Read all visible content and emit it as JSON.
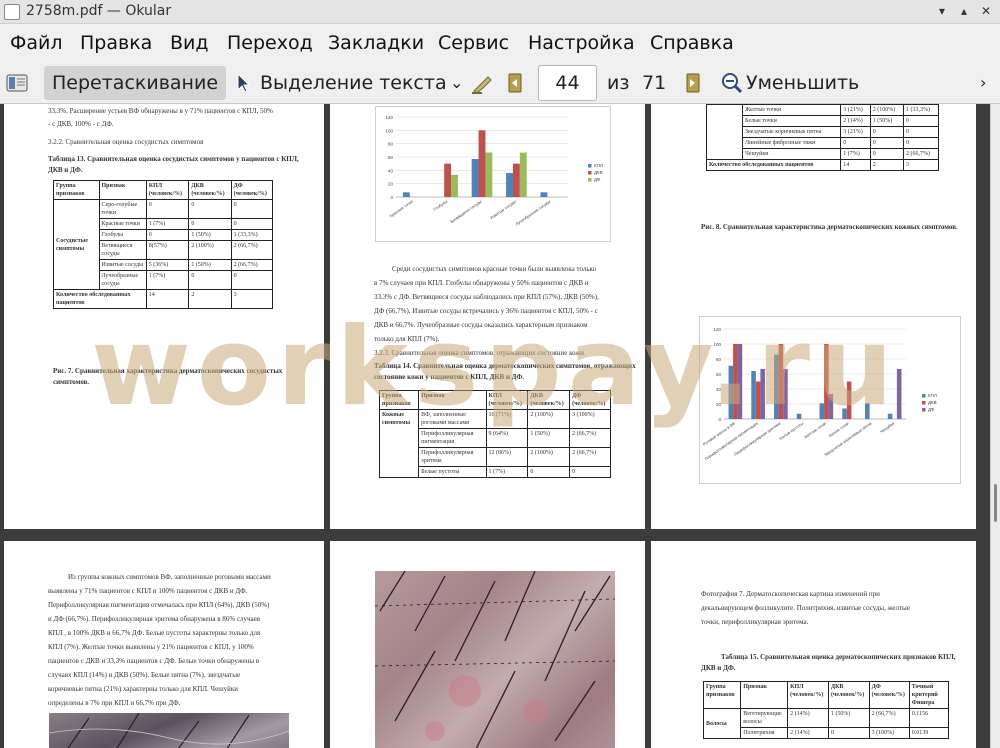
{
  "window": {
    "title": "2758m.pdf — Okular"
  },
  "menu": [
    "Файл",
    "Правка",
    "Вид",
    "Переход",
    "Закладки",
    "Сервис",
    "Настройка",
    "Справка"
  ],
  "toolbar": {
    "drag_label": "Перетаскивание",
    "select_label": "Выделение текста",
    "page_value": "44",
    "of_label": "из",
    "total_pages": "71",
    "zoom_out_label": "Уменьшить"
  },
  "watermark": "workspay.ru",
  "pages": {
    "p1": {
      "intro1": "33,3%. Расширение устьев ВФ обнаружены в у 71% пациентов с КПЛ, 50%",
      "intro2": "- с ДКВ, 100% - с ДФ.",
      "section": "3.2.2. Сравнительная оценка сосудистых симптомов",
      "table_title1": "Таблица 13. Сравнительная оценка сосудистых симптомов у пациентов с КПЛ,",
      "table_title2": "ДКВ и ДФ.",
      "table": {
        "headers": [
          "Группа признаков",
          "Признак",
          "КПЛ (человек/%)",
          "ДКВ (человек/%)",
          "ДФ (человек/%)"
        ],
        "group": "Сосудистые симптомы",
        "rows": [
          [
            "Серо-голубые точки",
            "0",
            "0",
            "0"
          ],
          [
            "Красные точки",
            "1 (7%)",
            "0",
            "0"
          ],
          [
            "Глобулы",
            "0",
            "1 (50%)",
            "1 (33,3%)"
          ],
          [
            "Ветвящиеся сосуды",
            "8(57%)",
            "2 (100%)",
            "2 (66,7%)"
          ],
          [
            "Извитые сосуды",
            "5 (36%)",
            "1 (50%)",
            "2 (66,7%)"
          ],
          [
            "Лучеобразные сосуды",
            "1 (7%)",
            "0",
            "0"
          ]
        ],
        "total": [
          "Количество обследованных пациентов",
          "14",
          "2",
          "3"
        ]
      },
      "caption1": "Рис. 7. Сравнительная характеристика дерматоскопических сосудистых",
      "caption2": "симптомов."
    },
    "p2": {
      "chart": {
        "categories": [
          "Красные точки",
          "Глобулы",
          "Ветвящиеся сосуды",
          "Извитые сосуды",
          "Лучеобразные сосуды"
        ],
        "series": [
          {
            "name": "КПЛ",
            "color": "#4f81bd",
            "values": [
              7,
              0,
              57,
              36,
              7
            ]
          },
          {
            "name": "ДКВ",
            "color": "#c0504d",
            "values": [
              0,
              50,
              100,
              50,
              0
            ]
          },
          {
            "name": "ДФ",
            "color": "#9bbb59",
            "values": [
              0,
              33.3,
              66.7,
              66.7,
              0
            ]
          }
        ],
        "yticks": [
          "0",
          "20",
          "40",
          "60",
          "80",
          "100",
          "120"
        ],
        "ylim": [
          0,
          120
        ]
      },
      "para": [
        "Среди сосудистых симптомов красные точки были выявлены только",
        "в 7% случаев при КПЛ. Глобулы обнаружены у 50% пациентов с ДКВ и",
        "33,3% с ДФ. Ветвящиеся сосуды наблюдались при КПЛ (57%), ДКВ (50%),",
        "ДФ (66,7%). Извитые сосуды встречались у 36% пациентов с КПЛ, 50% - с",
        "ДКВ и 66,7%. Лучеобразные сосуды оказались характерным признаком",
        "только для КПЛ (7%)."
      ],
      "section": "3.2.3. Сравнительная оценка симптомов, отражающих состояние кожи",
      "table_title1": "Таблица 14. Сравнительная оценка дерматоскопических симптомов, отражающих",
      "table_title2": "состояние кожи у пациентов с КПЛ, ДКВ и ДФ.",
      "table": {
        "headers": [
          "Группа признаков",
          "Признак",
          "КПЛ (человек/%)",
          "ДКВ (человек/%)",
          "ДФ (человек/%)"
        ],
        "group": "Кожные симптомы",
        "rows": [
          [
            "ВФ, заполненные роговыми массами",
            "10 (71%)",
            "2 (100%)",
            "3 (100%)"
          ],
          [
            "Перифолликулярная пигментация",
            "9 (64%)",
            "1 (50%)",
            "2 (66,7%)"
          ],
          [
            "Перифолликулярная эритема",
            "12 (86%)",
            "2 (100%)",
            "2 (66,7%)"
          ],
          [
            "Белые пустоты",
            "1 (7%)",
            "0",
            "0"
          ]
        ]
      }
    },
    "p3": {
      "table": {
        "rows": [
          [
            "Желтые точки",
            "3 (21%)",
            "2 (100%)",
            "1 (33,3%)"
          ],
          [
            "Белые точки",
            "2 (14%)",
            "1 (50%)",
            "0"
          ],
          [
            "Звездчатые коричневые пятна",
            "3 (21%)",
            "0",
            "0"
          ],
          [
            "Линейные фиброзные тяжи",
            "0",
            "0",
            "0"
          ],
          [
            "Чешуйки",
            "1 (7%)",
            "0",
            "2 (66,7%)"
          ]
        ],
        "total": [
          "Количество обследованных пациентов",
          "14",
          "2",
          "3"
        ]
      },
      "caption": "Рис. 8. Сравнительная характеристика дерматоскопических кожных симптомов.",
      "chart": {
        "categories": [
          "Роговые массы в ВФ",
          "Перифолликулярная пигментация",
          "Перифолликулярная эритема",
          "Белые пустоты",
          "Желтые точки",
          "Белые точки",
          "Звездчатые коричневые пятна",
          "Чешуйки"
        ],
        "series": [
          {
            "name": "КПЛ",
            "color": "#4f81bd",
            "values": [
              71,
              64,
              86,
              7,
              21,
              14,
              21,
              7
            ]
          },
          {
            "name": "ДКВ",
            "color": "#c0504d",
            "values": [
              100,
              50,
              100,
              0,
              100,
              50,
              0,
              0
            ]
          },
          {
            "name": "ДФ",
            "color": "#8064a2",
            "values": [
              100,
              66.7,
              66.7,
              0,
              33.3,
              0,
              0,
              66.7
            ]
          }
        ],
        "yticks": [
          "0",
          "20",
          "40",
          "60",
          "80",
          "100",
          "120"
        ],
        "ylim": [
          0,
          120
        ]
      }
    },
    "p4": {
      "para": [
        "Из группы кожных симптомов ВФ, заполненные роговыми массами",
        "выявлены у 71% пациентов с КПЛ и 100% пациентов с ДКВ и ДФ.",
        "Перифолликулярная пигментация отмечалась при КПЛ (64%), ДКВ (50%)",
        "и ДФ (66,7%). Перифолликулярная эритема обнаружена в 86% случаев",
        "КПЛ , в 100% ДКВ и 66,7% ДФ. Белые пустоты характерны только для",
        "КПЛ (7%). Желтые точки выявлены у 21% пациентов с КПЛ, у 100%",
        "пациентов с ДКВ и 33,3% пациентов с ДФ. Белые точки обнаружены в",
        "случаях КПЛ (14%) и ДКВ (50%). Белые пятна (7%), звездчатые",
        "коричневые пятна (21%) характерны только для КПЛ. Чешуйки",
        "определены в 7% при КПЛ и 66,7% при ДФ."
      ]
    },
    "p6": {
      "photo_caption": [
        "Фотография 7. Дерматоскопическая картина изменений при",
        "декальвирующем фолликулите. Политрихия, извитые сосуды, желтые",
        "точки, перифолликулярная эритема."
      ],
      "table_title1": "Таблица 15. Сравнительная оценка дерматоскопических признаков КПЛ,",
      "table_title2": "ДКВ и ДФ.",
      "table": {
        "headers": [
          "Группа признаков",
          "Признак",
          "КПЛ (человек/%)",
          "ДКВ (человек/%)",
          "ДФ (человек/%)",
          "Точный критерий Фишера"
        ],
        "group": "Волосы",
        "rows": [
          [
            "Вегетирующие волосы",
            "2 (14%)",
            "1 (50%)",
            "2 (66,7%)",
            "0.1156"
          ],
          [
            "Политрихия",
            "2 (14%)",
            "0",
            "3 (100%)",
            "0.0139"
          ]
        ]
      }
    }
  }
}
